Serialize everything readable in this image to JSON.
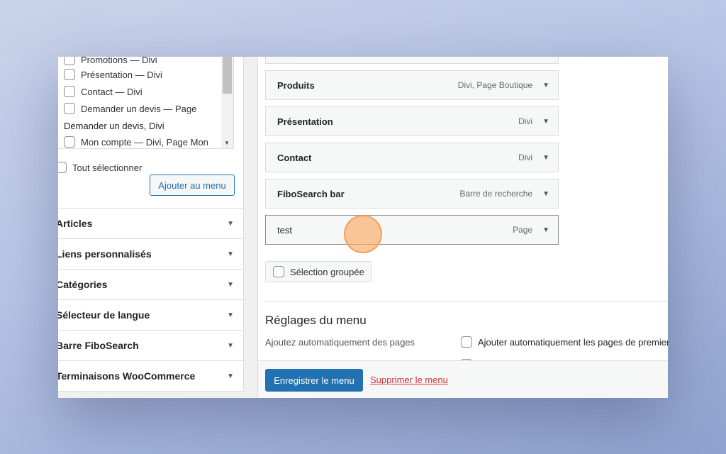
{
  "left_panel": {
    "pages_list": [
      {
        "label": "Promotions — Divi"
      },
      {
        "label": "Présentation — Divi"
      },
      {
        "label": "Contact — Divi"
      },
      {
        "label": "Demander un devis — Page"
      }
    ],
    "wrapped_line": "Demander un devis, Divi",
    "last_item": "Mon compte — Divi, Page Mon",
    "select_all": "Tout sélectionner",
    "add_button": "Ajouter au menu",
    "accordion": [
      {
        "label": "Articles"
      },
      {
        "label": "Liens personnalisés"
      },
      {
        "label": "Catégories"
      },
      {
        "label": "Sélecteur de langue"
      },
      {
        "label": "Barre FiboSearch"
      },
      {
        "label": "Terminaisons WooCommerce"
      }
    ]
  },
  "menu_structure": {
    "items": [
      {
        "title": "Produits",
        "type": "Divi, Page Boutique"
      },
      {
        "title": "Présentation",
        "type": "Divi"
      },
      {
        "title": "Contact",
        "type": "Divi"
      },
      {
        "title": "FiboSearch bar",
        "type": "Barre de recherche"
      },
      {
        "title": "test",
        "type": "Page"
      }
    ],
    "bulk_select": "Sélection groupée"
  },
  "menu_settings": {
    "title": "Réglages du menu",
    "auto_add_label": "Ajoutez automatiquement des pages",
    "auto_add_option": "Ajouter automatiquement les pages de premier"
  },
  "footer": {
    "save_button": "Enregistrer le menu",
    "delete_link": "Supprimer le menu"
  },
  "colors": {
    "accent": "#2271b1",
    "delete": "#d63638",
    "cursor_highlight": "#f5a964"
  }
}
